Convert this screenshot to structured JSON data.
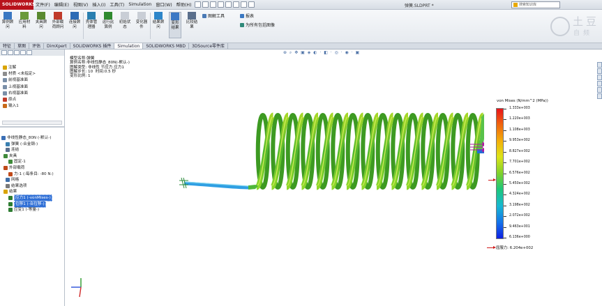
{
  "menubar": {
    "logo": "SOLIDWORKS",
    "items": [
      "文件(F)",
      "编辑(E)",
      "视图(V)",
      "插入(I)",
      "工具(T)",
      "Simulation",
      "窗口(W)",
      "帮助(H)"
    ],
    "doc_title": "弹簧.SLDPRT *",
    "search_placeholder": "搜索知识库"
  },
  "ribbon": {
    "tools": [
      {
        "label": "算例顾问",
        "color": "#3a78c2"
      },
      {
        "label": "应用材料",
        "color": "#6a9a3a"
      },
      {
        "label": "夹具顾问",
        "color": "#5a8a30"
      },
      {
        "label": "外部载荷顾问",
        "color": "#c03a2a"
      },
      {
        "label": "连接顾问",
        "color": "#2d6bb5"
      },
      {
        "label": "壳体管理器",
        "color": "#2a7fb0"
      },
      {
        "label": "运行此算例",
        "color": "#2f8a2f"
      },
      {
        "label": "初始状态",
        "color": "#9aa2ad"
      },
      {
        "label": "变化器件",
        "color": "#9aa2ad"
      },
      {
        "label": "结果顾问",
        "color": "#2e86c9"
      },
      {
        "label": "变形结果",
        "color": "#3b77c4"
      },
      {
        "label": "比较结果",
        "color": "#5a6f8c"
      }
    ],
    "right_tools": [
      "图解工具",
      "报表",
      "为所有包括图像"
    ],
    "watermark_line1": "土豆",
    "watermark_line2": "自频"
  },
  "tabs": [
    "特征",
    "草图",
    "评估",
    "DimXpert",
    "SOLIDWORKS 插件",
    "Simulation",
    "SOLIDWORKS MBD",
    "3DSource零件库"
  ],
  "tree_top": [
    {
      "label": "注解",
      "color": "#d9a400"
    },
    {
      "label": "材质 <未指定>",
      "color": "#8d8d8d"
    },
    {
      "label": "前视基准面",
      "color": "#7a8fa8"
    },
    {
      "label": "上视基准面",
      "color": "#7a8fa8"
    },
    {
      "label": "右视基准面",
      "color": "#7a8fa8"
    },
    {
      "label": "原点",
      "color": "#c23b2a"
    },
    {
      "label": "输入1",
      "color": "#c86a1a"
    }
  ],
  "tree_study": [
    {
      "label": "非线性静态_80N (-默认-)",
      "color": "#3b6fb5",
      "indent": 2
    },
    {
      "label": "弹簧 (-合金钢-)",
      "color": "#3a7fb0",
      "indent": 8
    },
    {
      "label": "连结",
      "color": "#5c6f8c",
      "indent": 8
    },
    {
      "label": "夹具",
      "color": "#3f8a3a",
      "indent": 5
    },
    {
      "label": "固定-1",
      "color": "#3f8a3a",
      "indent": 12
    },
    {
      "label": "外部载荷",
      "color": "#c04a1a",
      "indent": 5
    },
    {
      "label": "力-1 (:每条目: -80 N:)",
      "color": "#c04a1a",
      "indent": 12
    },
    {
      "label": "网格",
      "color": "#3f6fa8",
      "indent": 8
    },
    {
      "label": "结果选项",
      "color": "#7a7a7a",
      "indent": 8
    },
    {
      "label": "结果",
      "color": "#d9a400",
      "indent": 5
    },
    {
      "label": "应力1 (-vonMises-)",
      "color": "#2e7d32",
      "indent": 12,
      "selected": true
    },
    {
      "label": "位移1 (-合位移-)",
      "color": "#2e7d32",
      "indent": 12,
      "selected": true
    },
    {
      "label": "应变1 (-等量-)",
      "color": "#2e7d32",
      "indent": 12,
      "selected": false
    }
  ],
  "info": {
    "line1": "模型名称:弹簧",
    "line2": "算例名称:非线性静态_80N(-默认-)",
    "line3": "图解类型: 非线性 节应力 应力1",
    "line4": "图解步长: 10  时间:0.5 秒",
    "line5": "变形比例: 1"
  },
  "legend": {
    "title": "von Mises (N/mm^2 (MPa))",
    "values": [
      "1.333e+003",
      "1.220e+003",
      "1.108e+003",
      "9.953e+002",
      "8.827e+002",
      "7.701e+002",
      "6.576e+002",
      "5.450e+002",
      "4.324e+002",
      "3.198e+002",
      "2.072e+002",
      "9.463e+001",
      "6.136e+000"
    ],
    "yield_label": "屈服力: 6.204e+002"
  }
}
